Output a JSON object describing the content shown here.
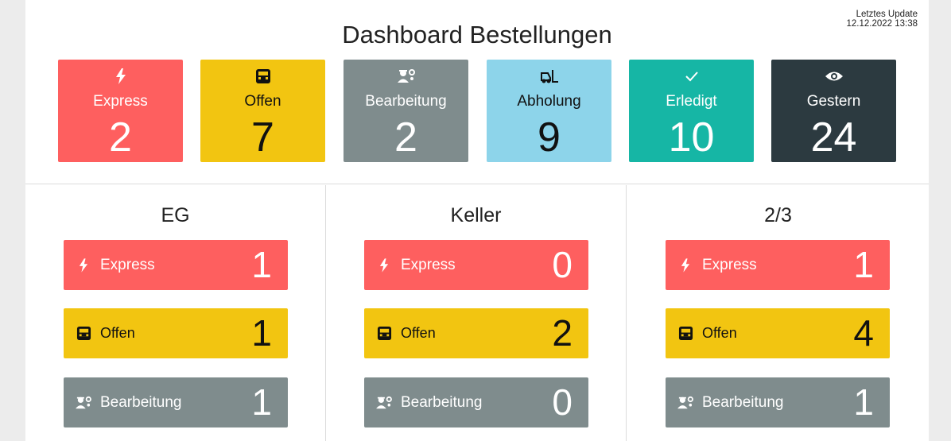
{
  "header": {
    "title": "Dashboard Bestellungen",
    "update_label": "Letztes Update",
    "update_time": "12.12.2022 13:38"
  },
  "summary": [
    {
      "label": "Express",
      "count": "2",
      "icon": "bolt-icon",
      "color": "#fe5f5f"
    },
    {
      "label": "Offen",
      "count": "7",
      "icon": "inbox-icon",
      "color": "#f2c511"
    },
    {
      "label": "Bearbeitung",
      "count": "2",
      "icon": "workers-icon",
      "color": "#7f8c8d"
    },
    {
      "label": "Abholung",
      "count": "9",
      "icon": "forklift-icon",
      "color": "#8dd4ea"
    },
    {
      "label": "Erledigt",
      "count": "10",
      "icon": "check-icon",
      "color": "#16b6a5"
    },
    {
      "label": "Gestern",
      "count": "24",
      "icon": "eye-icon",
      "color": "#2c3a40"
    }
  ],
  "locations": [
    {
      "name": "EG",
      "rows": [
        {
          "label": "Express",
          "count": "1"
        },
        {
          "label": "Offen",
          "count": "1"
        },
        {
          "label": "Bearbeitung",
          "count": "1"
        }
      ]
    },
    {
      "name": "Keller",
      "rows": [
        {
          "label": "Express",
          "count": "0"
        },
        {
          "label": "Offen",
          "count": "2"
        },
        {
          "label": "Bearbeitung",
          "count": "0"
        }
      ]
    },
    {
      "name": "2/3",
      "rows": [
        {
          "label": "Express",
          "count": "1"
        },
        {
          "label": "Offen",
          "count": "4"
        },
        {
          "label": "Bearbeitung",
          "count": "1"
        }
      ]
    }
  ]
}
